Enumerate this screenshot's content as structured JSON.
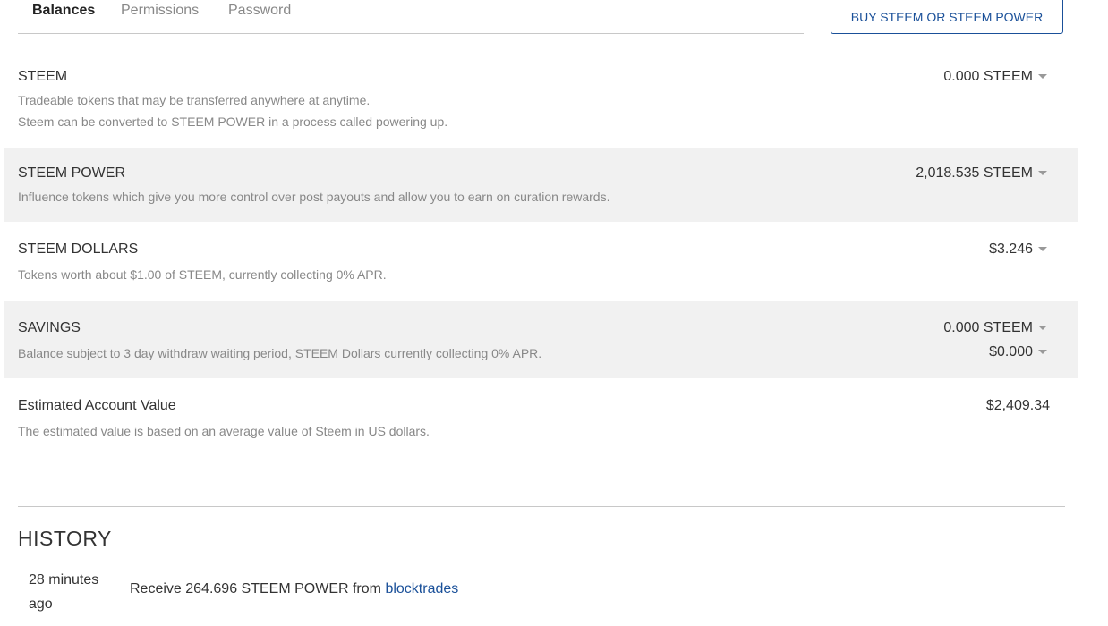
{
  "tabs": {
    "balances": "Balances",
    "permissions": "Permissions",
    "password": "Password"
  },
  "buy_button": "BUY STEEM OR STEEM POWER",
  "balances": {
    "steem": {
      "title": "STEEM",
      "desc_line1": "Tradeable tokens that may be transferred anywhere at anytime.",
      "desc_line2": "Steem can be converted to STEEM POWER in a process called powering up.",
      "amount": "0.000 STEEM"
    },
    "steem_power": {
      "title": "STEEM POWER",
      "desc": "Influence tokens which give you more control over post payouts and allow you to earn on curation rewards.",
      "amount": "2,018.535 STEEM"
    },
    "steem_dollars": {
      "title": "STEEM DOLLARS",
      "desc": "Tokens worth about $1.00 of STEEM, currently collecting 0% APR.",
      "amount": "$3.246"
    },
    "savings": {
      "title": "SAVINGS",
      "desc": "Balance subject to 3 day withdraw waiting period, STEEM Dollars currently collecting 0% APR.",
      "amount_steem": "0.000 STEEM",
      "amount_sbd": "$0.000"
    },
    "estimated": {
      "title": "Estimated Account Value",
      "desc": "The estimated value is based on an average value of Steem in US dollars.",
      "amount": "$2,409.34"
    }
  },
  "history": {
    "title": "HISTORY",
    "items": [
      {
        "time": "28 minutes ago",
        "text": "Receive 264.696 STEEM POWER from ",
        "from": "blocktrades"
      }
    ]
  },
  "colors": {
    "link": "#1a5099",
    "shade": "#f1f1f1",
    "muted": "#888888"
  }
}
